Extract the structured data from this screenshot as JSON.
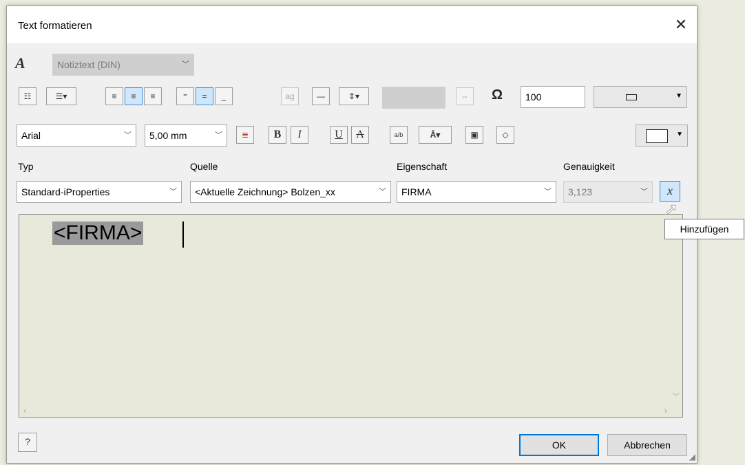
{
  "dialog": {
    "title": "Text formatieren",
    "close_glyph": "✕"
  },
  "style": {
    "icon": "A",
    "value": "Notiztext (DIN)"
  },
  "toolbar1": {
    "list_icons": [
      "bullets-icon",
      "numbering-icon"
    ],
    "stretch_value": "100",
    "rule_icon": "line-icon",
    "justify_icons": [
      "align-left-icon",
      "align-center-icon",
      "align-right-icon"
    ]
  },
  "toolbar2": {
    "font": "Arial",
    "size": "5,00 mm",
    "bold": "B",
    "italic": "I",
    "underline": "U",
    "strike": "A"
  },
  "labels": {
    "typ": "Typ",
    "quelle": "Quelle",
    "eigenschaft": "Eigenschaft",
    "genauigkeit": "Genauigkeit"
  },
  "selects": {
    "typ": "Standard-iProperties",
    "quelle": "<Aktuelle Zeichnung> Bolzen_xx",
    "eigenschaft": "FIRMA",
    "genauigkeit": "3,123"
  },
  "add_button": {
    "glyph": "x",
    "tooltip": "Hinzufügen"
  },
  "editor": {
    "content": "<FIRMA>"
  },
  "footer": {
    "help_icon": "?",
    "ok": "OK",
    "cancel": "Abbrechen"
  }
}
